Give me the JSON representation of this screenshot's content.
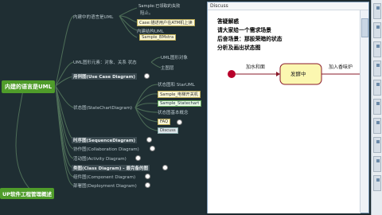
{
  "mindmap": {
    "root_label": "内建的语言是UML",
    "bottom_label": "UP软件工程管理概述",
    "top_group_label": "内建中的语言是UML",
    "top_box1": "Sample:已领取的失败",
    "top_box1_sub": "阻止。",
    "top_box2": "Case:描述用户在ATM机上读",
    "top_box3": "内建结构UML",
    "top_box4": "Sample_BMstra",
    "uml_line": "UML图形元素：对象、关系",
    "uml_line_tail": "状态",
    "uml_right1": "UML图形对象",
    "uml_right2": "主图层",
    "use_case": "用例图(Use Case Diagram)",
    "state_diagram": "状态图(StateChartDiagram)",
    "sc_label1": "状态图和 StarUML",
    "sc_box1": "Sample_电梯开关机",
    "sc_box2": "Sample_Statechart",
    "sc_label2": "状态图基本概念",
    "faq": "FAQ",
    "discuss": "Discuss",
    "sequence": "时序图(SequenceDiagram)",
    "collab": "协作图(Collaboration Diagram)",
    "activity": "活动图(Activity Diagram)",
    "class_diag": "类图(Class Diagram) - 最完备的图",
    "component": "组件图(Component Diagram)",
    "deployment": "部署图(Deployment Diagram)"
  },
  "panel": {
    "title": "Discuss",
    "line1": "答疑解惑",
    "line2": "请大家给一个需求场景",
    "line3": "后奋场景：那股荣暗的状态",
    "line4": "分析及画出状态图",
    "transition_label": "加水和面",
    "state_label": "发酵中",
    "exit_label": "加入香味炉"
  },
  "colors": {
    "root_green": "#4f9c2a",
    "state_fill": "#fbf7b0",
    "initial_state": "#b8002a"
  },
  "sidebar": {
    "icons": [
      "tab-icon",
      "tab-icon",
      "tab-icon",
      "tab-icon",
      "tab-icon",
      "tab-icon",
      "tab-icon",
      "tab-icon",
      "tab-icon",
      "tab-icon"
    ]
  }
}
